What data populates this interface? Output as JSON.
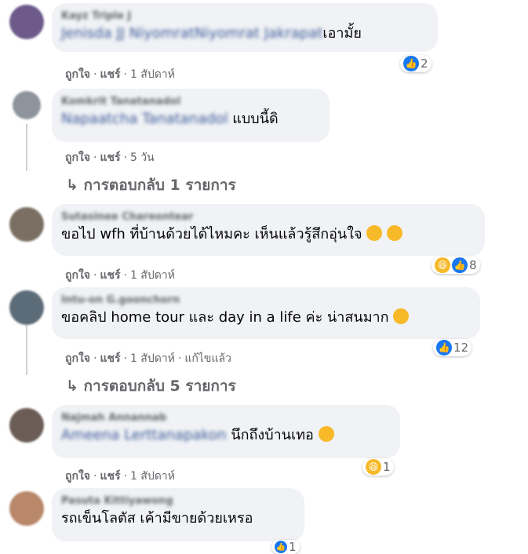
{
  "comments": [
    {
      "name": "Kayz Triple J",
      "mention": "Jenisda JJ NiyomratNiyomrat Jakrapat",
      "text": "เอามั้ย",
      "like_label": "ถูกใจ",
      "share_label": "แชร์",
      "time": "1 สัปดาห์",
      "reaction_count": "2"
    },
    {
      "name": "Komkrit Tanatanadol",
      "mention": "Napaatcha Tanatanadol",
      "text": " แบบนี้ดิ",
      "like_label": "ถูกใจ",
      "share_label": "แชร์",
      "time": "5 วัน",
      "replies_label": "↳ การตอบกลับ 1 รายการ"
    },
    {
      "name": "Sutasinee Chareontear",
      "text": "ขอไป wfh ที่บ้านด้วยได้ไหมคะ เห็นแล้วรู้สึกอุ่นใจ",
      "like_label": "ถูกใจ",
      "share_label": "แชร์",
      "time": "1 สัปดาห์",
      "reaction_count": "8"
    },
    {
      "name": "Intu-on G.goonchorn",
      "text": "ขอคลิป home tour และ day in a life ค่ะ น่าสนมาก",
      "like_label": "ถูกใจ",
      "share_label": "แชร์",
      "time": "1 สัปดาห์",
      "edited": "แก้ไขแล้ว",
      "reaction_count": "12",
      "replies_label": "↳ การตอบกลับ 5 รายการ"
    },
    {
      "name": "Najmah Annannab",
      "mention": "Ameena Lerttanapakon",
      "text": " นึกถึงบ้านเทอ",
      "like_label": "ถูกใจ",
      "share_label": "แชร์",
      "time": "1 สัปดาห์",
      "reaction_count": "1"
    },
    {
      "name": "Pasuta Kittiyawong",
      "text": "รถเข็นโลตัส เค้ามีขายด้วยเหรอ",
      "reaction_count": "1"
    }
  ],
  "colors": {
    "bubble": "#f0f2f5",
    "meta": "#65676b",
    "like": "#1877f2",
    "haha": "#f7b928"
  },
  "icons": {
    "like": "thumbs-up-icon",
    "haha": "laughing-face-icon",
    "love_eyes": "heart-eyes-face-icon",
    "relieved": "relieved-face-icon",
    "rofl": "rolling-laughing-face-icon"
  }
}
